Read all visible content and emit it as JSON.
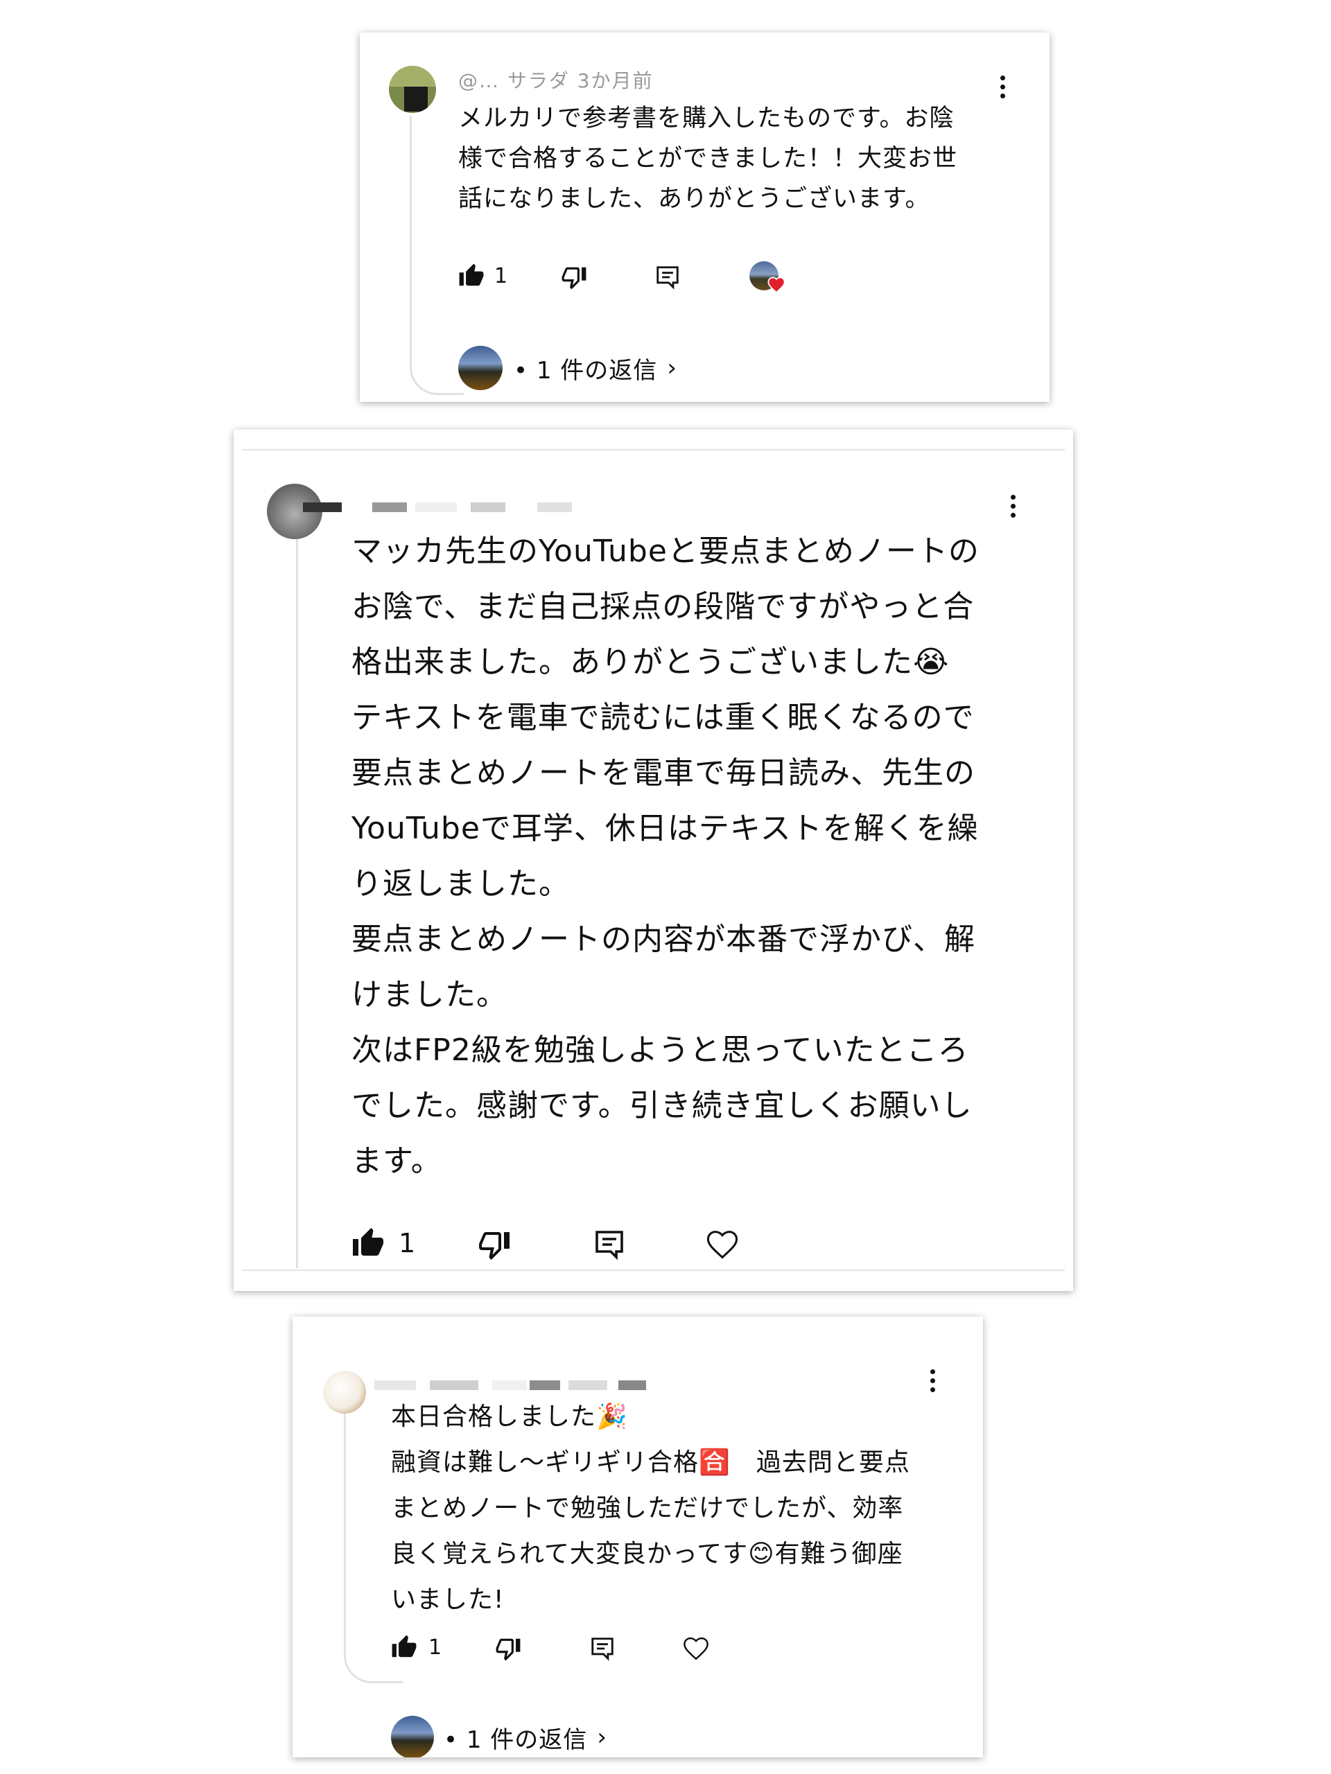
{
  "comments": [
    {
      "header": "@… サラダ 3か月前",
      "text": "メルカリで参考書を購入したものです。お陰\n様で合格することができました！！大変お世\n話になりました、ありがとうございます。",
      "like_count": "1",
      "replies_label": "• 1 件の返信",
      "hearted": true,
      "has_replies": true
    },
    {
      "header": "",
      "text": "マッカ先生のYouTubeと要点まとめノートの\nお陰で、まだ自己採点の段階ですがやっと合\n格出来ました。ありがとうございました😭\nテキストを電車で読むには重く眠くなるので\n要点まとめノートを電車で毎日読み、先生の\nYouTubeで耳学、休日はテキストを解くを繰\nり返しました。\n要点まとめノートの内容が本番で浮かび、解\nけました。\n次はFP2級を勉強しようと思っていたところ\nでした。感謝です。引き続き宜しくお願いし\nます。",
      "like_count": "1",
      "hearted": false,
      "has_replies": false
    },
    {
      "header": "",
      "text": "本日合格しました🎉\n融資は難し〜ギリギリ合格🈴　過去問と要点\nまとめノートで勉強しただけでしたが、効率\n良く覚えられて大変良かってす😊有難う御座\nいました!",
      "like_count": "1",
      "replies_label": "• 1 件の返信",
      "hearted": false,
      "has_replies": true
    }
  ],
  "icons": {
    "like": "thumbs-up-icon",
    "dislike": "thumbs-down-icon",
    "reply": "reply-icon",
    "heart": "heart-icon",
    "more": "more-vert-icon",
    "chevron": "chevron-right-icon"
  },
  "colors": {
    "heart_red": "#e0202a",
    "thread_line": "#e1e1e1",
    "text": "#111111"
  }
}
